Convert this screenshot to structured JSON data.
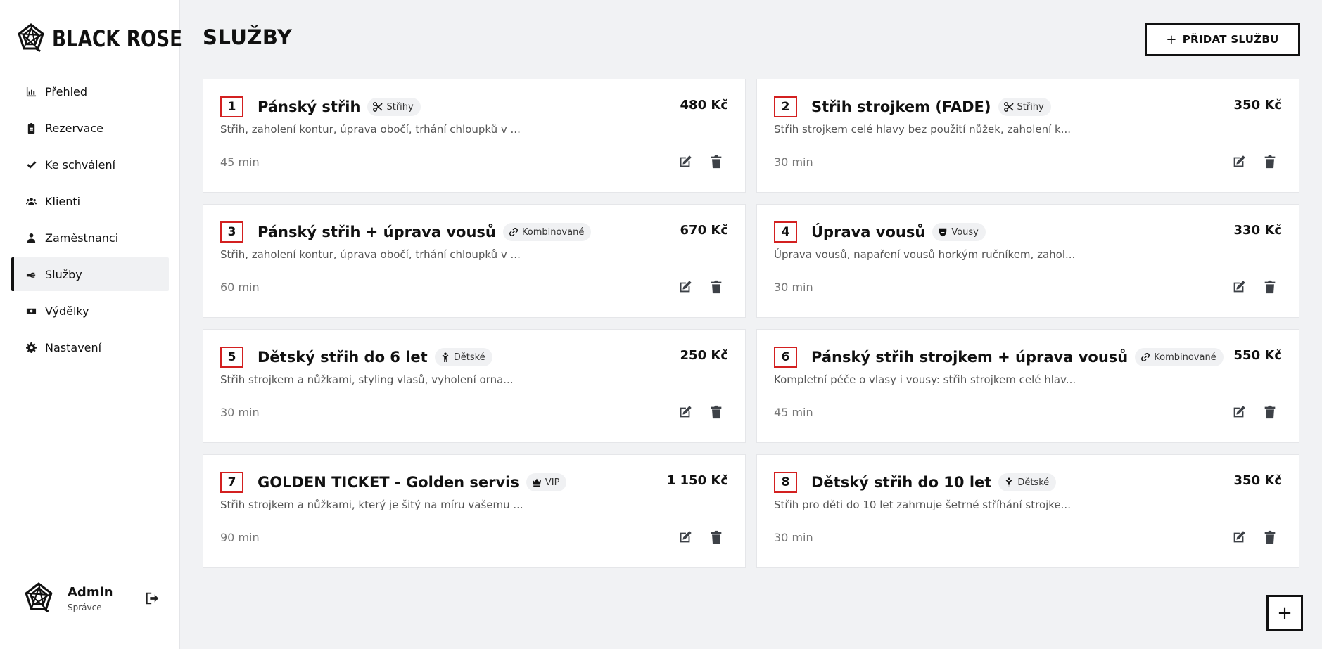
{
  "brand": {
    "name": "BLACK ROSE"
  },
  "nav": [
    {
      "label": "Přehled",
      "icon": "bar-chart-icon",
      "active": false
    },
    {
      "label": "Rezervace",
      "icon": "clipboard-icon",
      "active": false
    },
    {
      "label": "Ke schválení",
      "icon": "check-icon",
      "active": false
    },
    {
      "label": "Klienti",
      "icon": "users-icon",
      "active": false
    },
    {
      "label": "Zaměstnanci",
      "icon": "employee-icon",
      "active": false
    },
    {
      "label": "Služby",
      "icon": "scissors-hand-icon",
      "active": true
    },
    {
      "label": "Výdělky",
      "icon": "money-icon",
      "active": false
    },
    {
      "label": "Nastavení",
      "icon": "gear-icon",
      "active": false
    }
  ],
  "user": {
    "name": "Admin",
    "role": "Správce"
  },
  "page": {
    "title": "SLUŽBY",
    "add_label": "PŘIDAT SLUŽBU",
    "add_icon": "+",
    "fab_icon": "+"
  },
  "services": [
    {
      "num": "1",
      "title": "Pánský střih",
      "tag": "Střihy",
      "tag_icon": "scissors-icon",
      "price": "480 Kč",
      "desc": "Střih, zaholení kontur, úprava obočí, trhání chloupků v ...",
      "duration": "45 min"
    },
    {
      "num": "2",
      "title": "Střih strojkem (FADE)",
      "tag": "Střihy",
      "tag_icon": "scissors-icon",
      "price": "350 Kč",
      "desc": "Střih strojkem celé hlavy bez použití nůžek, zaholení k...",
      "duration": "30 min"
    },
    {
      "num": "3",
      "title": "Pánský střih + úprava vousů",
      "tag": "Kombinované",
      "tag_icon": "link-icon",
      "price": "670 Kč",
      "desc": "Střih, zaholení kontur, úprava obočí, trhání chloupků v ...",
      "duration": "60 min"
    },
    {
      "num": "4",
      "title": "Úprava vousů",
      "tag": "Vousy",
      "tag_icon": "beard-icon",
      "price": "330 Kč",
      "desc": "Úprava vousů, napaření vousů horkým ručníkem, zahol...",
      "duration": "30 min"
    },
    {
      "num": "5",
      "title": "Dětský střih do 6 let",
      "tag": "Dětské",
      "tag_icon": "child-icon",
      "price": "250 Kč",
      "desc": "Střih strojkem a nůžkami, styling vlasů, vyholení orna...",
      "duration": "30 min"
    },
    {
      "num": "6",
      "title": "Pánský střih strojkem + úprava vousů",
      "tag": "Kombinované",
      "tag_icon": "link-icon",
      "price": "550 Kč",
      "desc": "Kompletní péče o vlasy i vousy: střih strojkem celé hlav...",
      "duration": "45 min"
    },
    {
      "num": "7",
      "title": "GOLDEN TICKET - Golden servis",
      "tag": "VIP",
      "tag_icon": "crown-icon",
      "price": "1 150 Kč",
      "desc": "Střih strojkem a nůžkami, který je šitý na míru vašemu ...",
      "duration": "90 min"
    },
    {
      "num": "8",
      "title": "Dětský střih do 10 let",
      "tag": "Dětské",
      "tag_icon": "child-icon",
      "price": "350 Kč",
      "desc": "Střih pro děti do 10 let zahrnuje šetrné stříhání strojke...",
      "duration": "30 min"
    }
  ]
}
